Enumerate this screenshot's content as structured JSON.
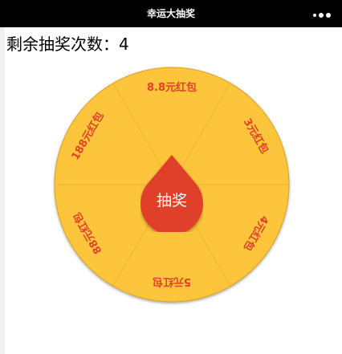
{
  "app": {
    "title": "幸运大抽奖",
    "more_icon": "ellipsis-icon"
  },
  "counter": {
    "text": "剩余抽奖次数：4"
  },
  "wheel": {
    "colors": {
      "sector": "#fcc53a",
      "divider": "#f2b233",
      "rim": "#d9a22a",
      "prize_text": "#e0412a",
      "button": "#e0412a"
    },
    "prizes": [
      "8.8元红包",
      "3元红包",
      "4元红包",
      "5元红包",
      "88元红包",
      "188元红包"
    ],
    "button_label": "抽奖"
  }
}
